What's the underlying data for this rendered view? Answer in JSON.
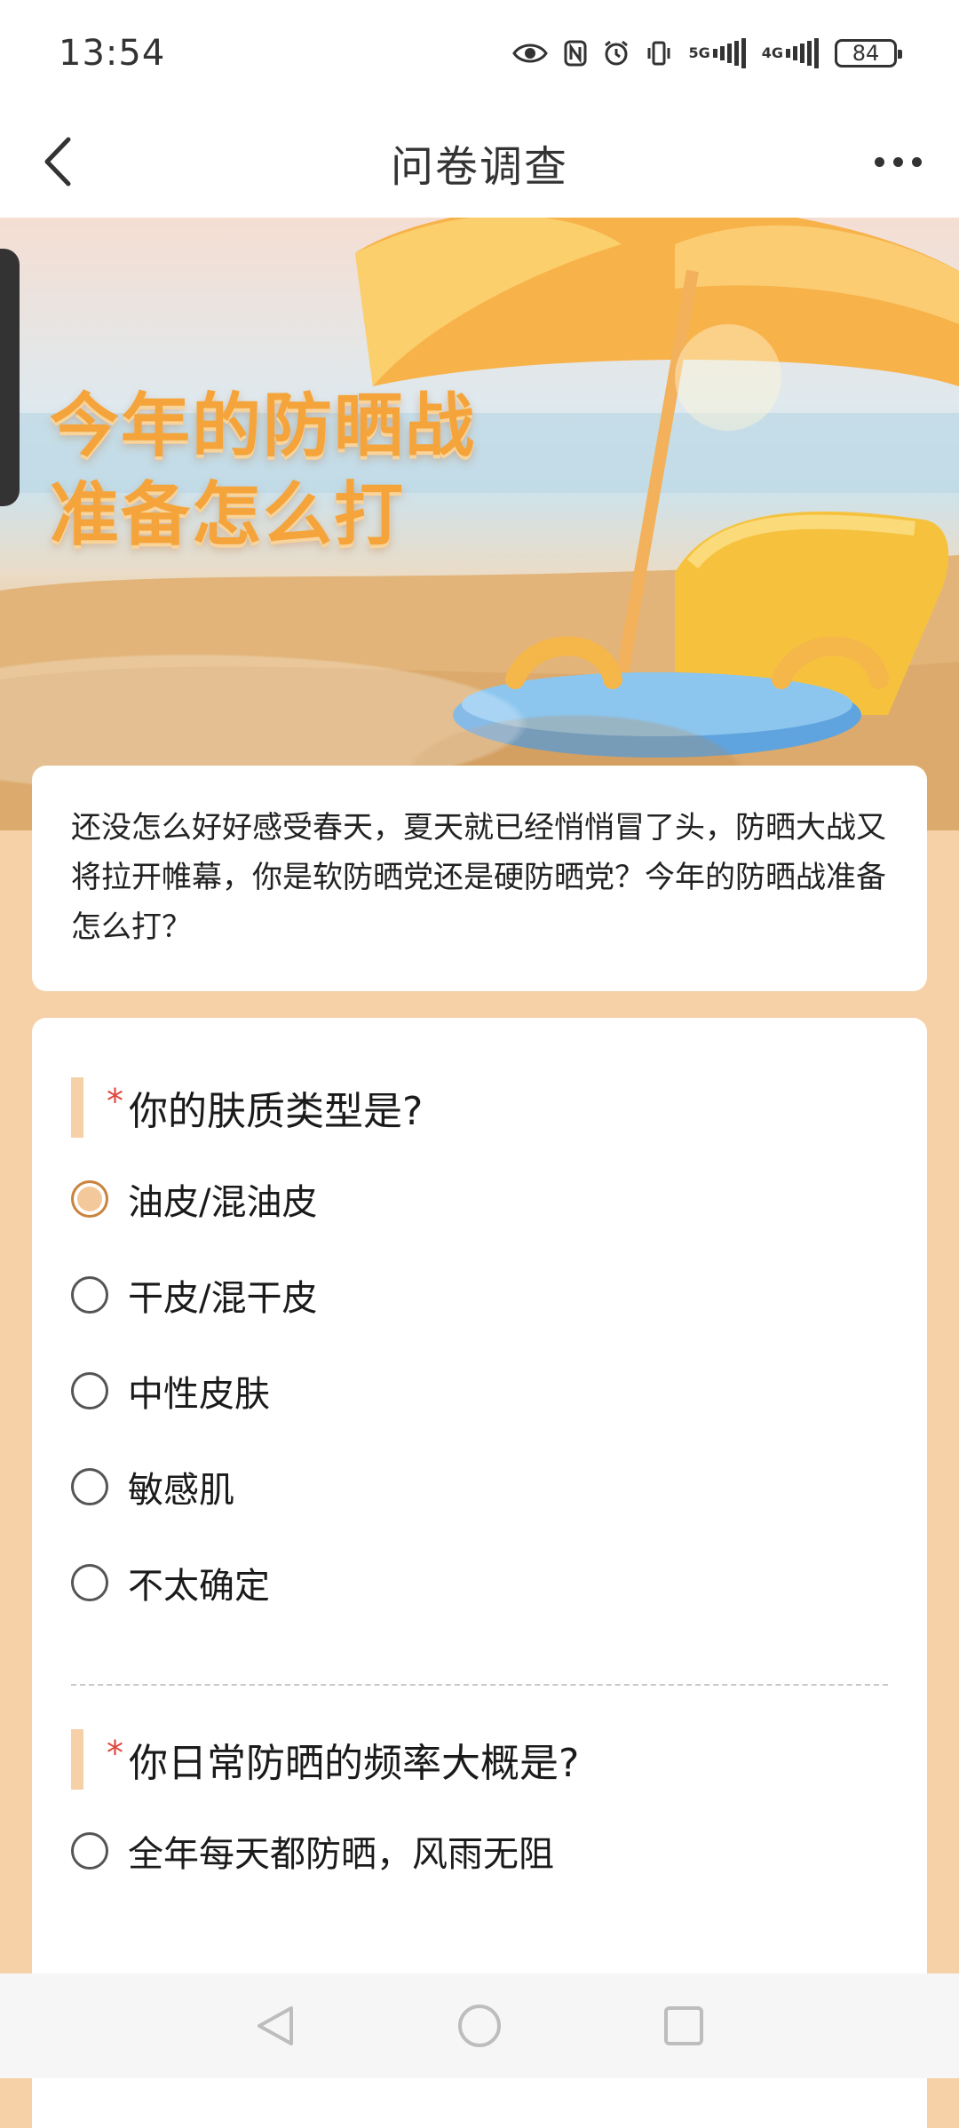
{
  "status_bar": {
    "time": "13:54",
    "net_5g": "5G",
    "net_4g": "4G",
    "battery": "84"
  },
  "header": {
    "title": "问卷调查"
  },
  "banner": {
    "headline_line1": "今年的防晒战",
    "headline_line2": "准备怎么打"
  },
  "intro": {
    "text": "还没怎么好好感受春天，夏天就已经悄悄冒了头，防晒大战又将拉开帷幕，你是软防晒党还是硬防晒党？今年的防晒战准备怎么打？"
  },
  "questions": [
    {
      "required_mark": "*",
      "text": "你的肤质类型是?",
      "options": [
        {
          "label": "油皮/混油皮",
          "selected": true
        },
        {
          "label": "干皮/混干皮",
          "selected": false
        },
        {
          "label": "中性皮肤",
          "selected": false
        },
        {
          "label": "敏感肌",
          "selected": false
        },
        {
          "label": "不太确定",
          "selected": false
        }
      ]
    },
    {
      "required_mark": "*",
      "text": "你日常防晒的频率大概是?",
      "options": [
        {
          "label": "全年每天都防晒，风雨无阻",
          "selected": false
        }
      ]
    }
  ],
  "colors": {
    "accent": "#f6d0a6",
    "required": "#e0443a",
    "page_bg": "#f6d0a6"
  }
}
